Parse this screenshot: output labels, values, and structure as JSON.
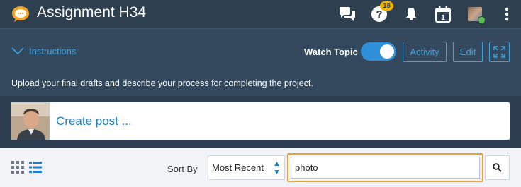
{
  "header": {
    "title": "Assignment H34",
    "notifications_badge": "18"
  },
  "subheader": {
    "instructions_label": "Instructions",
    "watch_label": "Watch Topic",
    "watch_on": true,
    "activity_label": "Activity",
    "edit_label": "Edit",
    "description": "Upload your final drafts and describe your process for completing the project."
  },
  "post": {
    "create_label": "Create post ..."
  },
  "toolbar": {
    "sort_label": "Sort By",
    "sort_value": "Most Recent",
    "search_value": "photo"
  },
  "colors": {
    "accent": "#3ba3e0",
    "toggle_on": "#2f8fd8",
    "badge": "#f0b400",
    "focus": "#e8a23a"
  }
}
